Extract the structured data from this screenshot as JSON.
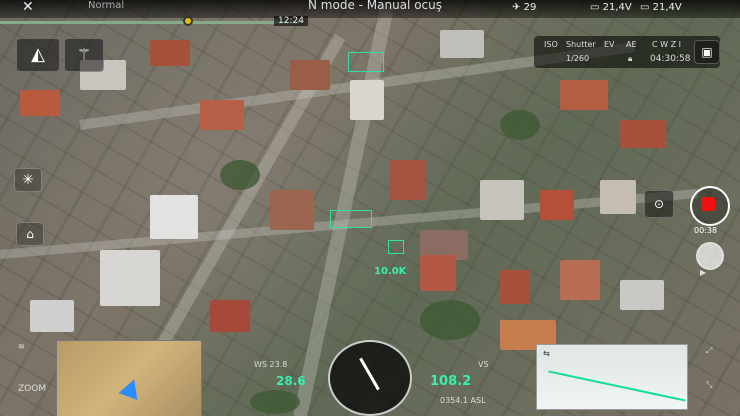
{
  "topbar": {
    "back_icon": "close-icon",
    "mode_label": "Normal",
    "title": "N mode - Manual ocuş",
    "satellites": "29",
    "battery1": "21,4V",
    "battery2": "21,4V",
    "time": "12:24"
  },
  "camera": {
    "iso_label": "ISO",
    "shutter_label": "Shutter",
    "shutter_value": "1/260",
    "ev_label": "EV",
    "ae_label": "AE",
    "wb_label": "C W Z I",
    "remaining_time": "04:30:58"
  },
  "hud": {
    "rec_time": "00:38",
    "ws_readout": "WS 23.8",
    "speed_left": "28.6",
    "vs_label": "VS",
    "alt_value": "108.2",
    "asl": "0354.1 ASL",
    "zoom_label": "ZOOM",
    "target_label": "10.0K"
  }
}
